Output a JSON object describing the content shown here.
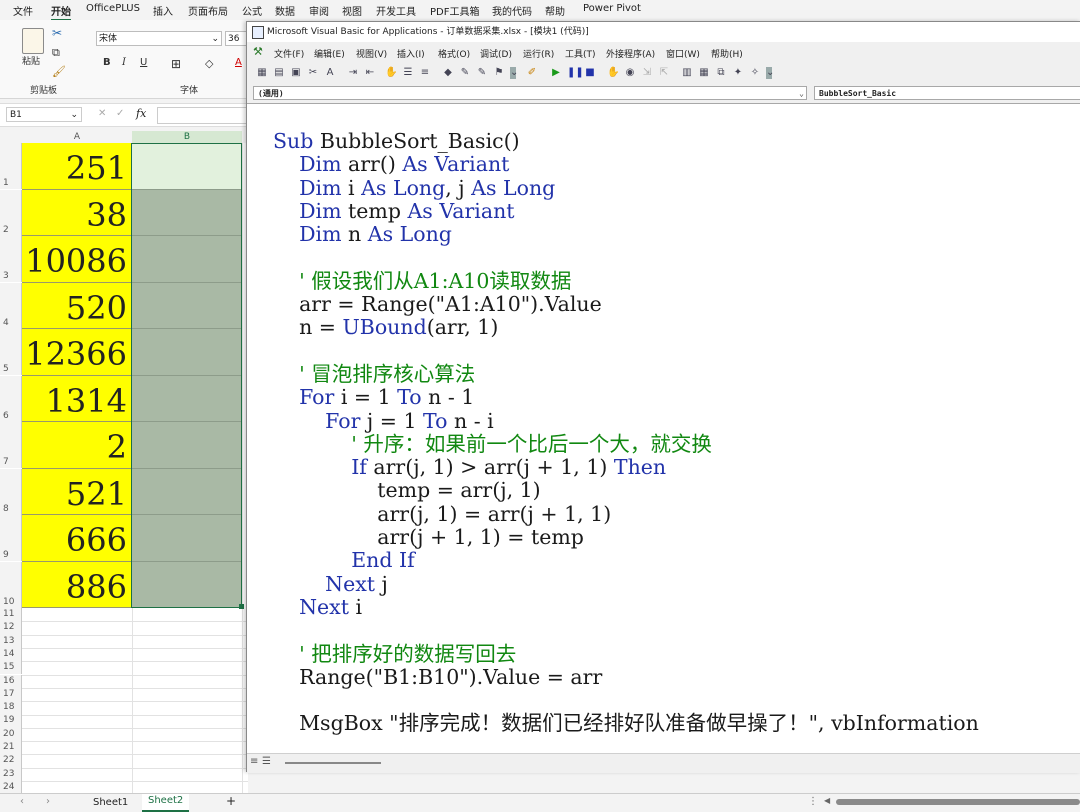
{
  "excel": {
    "ribbon_tabs": [
      "文件",
      "开始",
      "OfficePLUS",
      "插入",
      "页面布局",
      "公式",
      "数据",
      "审阅",
      "视图",
      "开发工具",
      "PDF工具箱",
      "我的代码",
      "帮助",
      "Power Pivot"
    ],
    "active_tab": "开始",
    "clipboard_group": "剪贴板",
    "paste_label": "粘贴",
    "font_group": "字体",
    "font_name": "宋体",
    "font_size": "36",
    "bold": "B",
    "italic": "I",
    "underline": "U",
    "name_box": "B1",
    "fx": "fx",
    "columns": [
      "A",
      "B"
    ],
    "cells_a": [
      "251",
      "38",
      "10086",
      "520",
      "12366",
      "1314",
      "2",
      "521",
      "666",
      "886"
    ],
    "extra_rows": [
      "11",
      "12",
      "13",
      "14",
      "15",
      "16",
      "17",
      "18",
      "19",
      "20",
      "21",
      "22",
      "23",
      "24"
    ],
    "sheets": [
      "Sheet1",
      "Sheet2"
    ],
    "active_sheet": "Sheet2",
    "add_sheet": "+"
  },
  "vba": {
    "title": "Microsoft Visual Basic for Applications - 订单数据采集.xlsx - [模块1 (代码)]",
    "menu": [
      "文件(F)",
      "编辑(E)",
      "视图(V)",
      "插入(I)",
      "格式(O)",
      "调试(D)",
      "运行(R)",
      "工具(T)",
      "外接程序(A)",
      "窗口(W)",
      "帮助(H)"
    ],
    "object_combo": "(通用)",
    "proc_combo": "BubbleSort_Basic",
    "code_lines": [
      "Sub BubbleSort_Basic()",
      "    Dim arr() As Variant",
      "    Dim i As Long, j As Long",
      "    Dim temp As Variant",
      "    Dim n As Long",
      "",
      "    ' 假设我们从A1:A10读取数据",
      "    arr = Range(\"A1:A10\").Value",
      "    n = UBound(arr, 1)",
      "",
      "    ' 冒泡排序核心算法",
      "    For i = 1 To n - 1",
      "        For j = 1 To n - i",
      "            ' 升序：如果前一个比后一个大，就交换",
      "            If arr(j, 1) > arr(j + 1, 1) Then",
      "                temp = arr(j, 1)",
      "                arr(j, 1) = arr(j + 1, 1)",
      "                arr(j + 1, 1) = temp",
      "            End If",
      "        Next j",
      "    Next i",
      "",
      "    ' 把排序好的数据写回去",
      "    Range(\"B1:B10\").Value = arr",
      "",
      "    MsgBox \"排序完成！数据们已经排好队准备做早操了！\", vbInformation"
    ]
  },
  "colors": {
    "cell_yellow": "#ffff00",
    "selection_green": "#a9b9a5",
    "vba_keyword": "#2233aa",
    "vba_comment": "#118811",
    "excel_accent": "#1e7145"
  }
}
